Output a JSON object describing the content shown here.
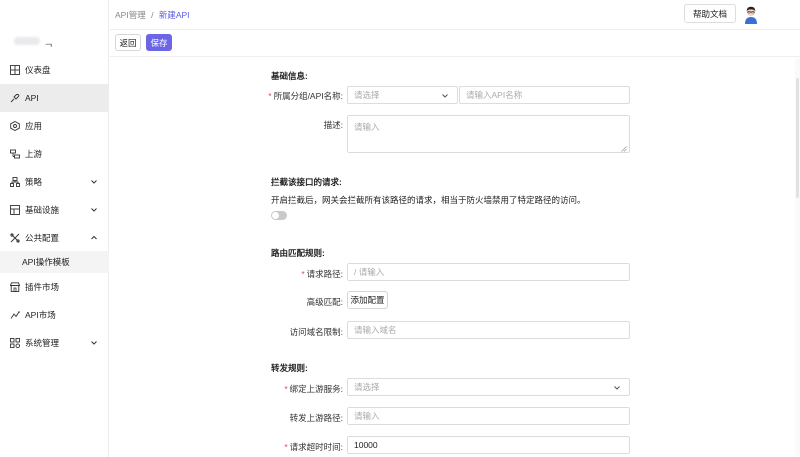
{
  "sidebar": {
    "logo_mark": "ᆨ",
    "items": [
      {
        "label": "仪表盘",
        "icon": "dashboard-grid-icon"
      },
      {
        "label": "API",
        "icon": "api-plug-icon",
        "active": true
      },
      {
        "label": "应用",
        "icon": "app-hexagon-icon"
      },
      {
        "label": "上游",
        "icon": "upstream-server-icon"
      },
      {
        "label": "策略",
        "icon": "policy-icon",
        "expandable": true
      },
      {
        "label": "基础设施",
        "icon": "infrastructure-icon",
        "expandable": true
      },
      {
        "label": "公共配置",
        "icon": "public-config-icon",
        "expanded": true
      },
      {
        "label": "插件市场",
        "icon": "plugin-store-icon"
      },
      {
        "label": "API市场",
        "icon": "api-market-icon"
      },
      {
        "label": "系统管理",
        "icon": "system-settings-icon",
        "expandable": true
      }
    ],
    "sub_items": [
      {
        "label": "API操作模板"
      }
    ]
  },
  "header": {
    "breadcrumb_parent": "API管理",
    "breadcrumb_sep": "/",
    "breadcrumb_current": "新建API",
    "help_label": "帮助文档"
  },
  "toolbar": {
    "back_label": "返回",
    "save_label": "保存"
  },
  "form": {
    "basic": {
      "title": "基础信息:",
      "group_label": "所属分组/API名称:",
      "group_placeholder": "请选择",
      "name_placeholder": "请输入API名称",
      "desc_label": "描述:",
      "desc_placeholder": "请输入"
    },
    "intercept": {
      "title": "拦截该接口的请求:",
      "desc": "开启拦截后，网关会拦截所有该路径的请求，相当于防火墙禁用了特定路径的访问。",
      "enabled": false
    },
    "route": {
      "title": "路由匹配规则:",
      "path_label": "请求路径:",
      "path_placeholder": "/ 请输入",
      "advanced_label": "高级匹配:",
      "advanced_button": "添加配置",
      "domain_label": "访问域名限制:",
      "domain_placeholder": "请输入域名"
    },
    "forward": {
      "title": "转发规则:",
      "upstream_label": "绑定上游服务:",
      "upstream_placeholder": "请选择",
      "forward_path_label": "转发上游路径:",
      "forward_path_placeholder": "请输入",
      "timeout_label": "请求超时时间:",
      "timeout_value": "10000"
    }
  },
  "colors": {
    "accent": "#6b66e6",
    "required": "#e5484d",
    "active_menu_bg": "#ececec"
  }
}
